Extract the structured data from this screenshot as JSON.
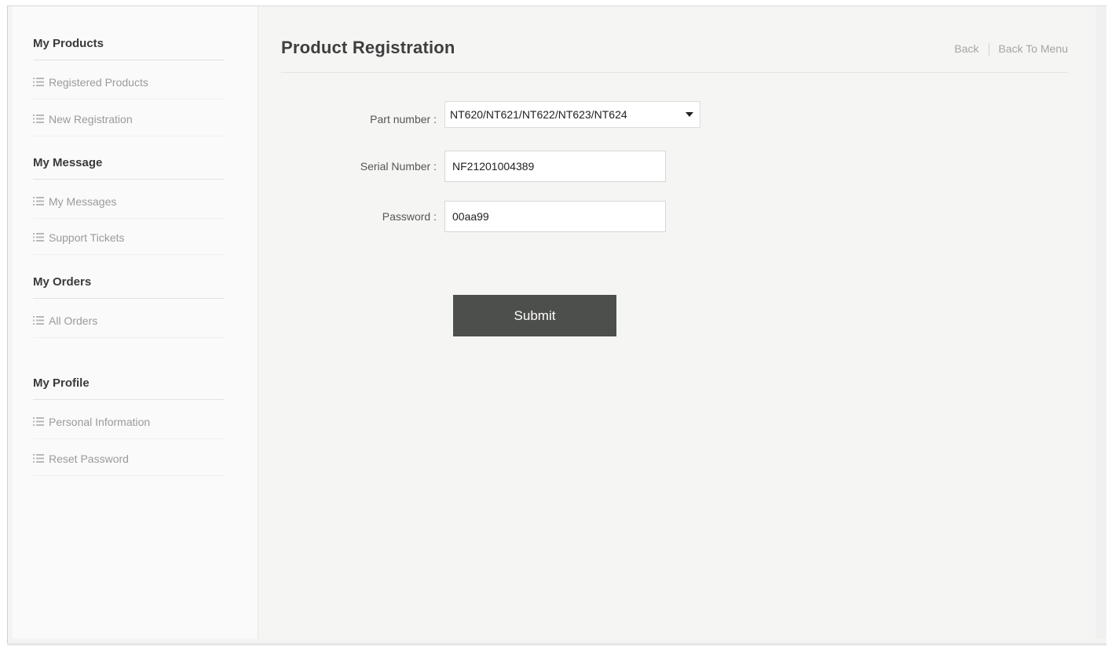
{
  "sidebar": {
    "sections": [
      {
        "title": "My Products",
        "items": [
          "Registered Products",
          "New Registration"
        ]
      },
      {
        "title": "My Message",
        "items": [
          "My Messages",
          "Support Tickets"
        ]
      },
      {
        "title": "My Orders",
        "items": [
          "All Orders"
        ]
      },
      {
        "title": "My Profile",
        "items": [
          "Personal Information",
          "Reset Password"
        ]
      }
    ]
  },
  "header": {
    "title": "Product Registration",
    "back_link": "Back",
    "back_to_menu_link": "Back To Menu"
  },
  "form": {
    "part_number": {
      "label": "Part number :",
      "selected": "NT620/NT621/NT622/NT623/NT624"
    },
    "serial_number": {
      "label": "Serial Number :",
      "value": "NF21201004389"
    },
    "password": {
      "label": "Password :",
      "value": "00aa99"
    },
    "submit_label": "Submit"
  },
  "colors": {
    "submit_bg": "#4c4f4b",
    "main_bg": "#f5f6f4",
    "sidebar_bg": "#fafafa",
    "muted_text": "#9a9a9a"
  },
  "icons": {
    "sidebar_item": "list-icon",
    "select_arrow": "caret-down-icon"
  }
}
